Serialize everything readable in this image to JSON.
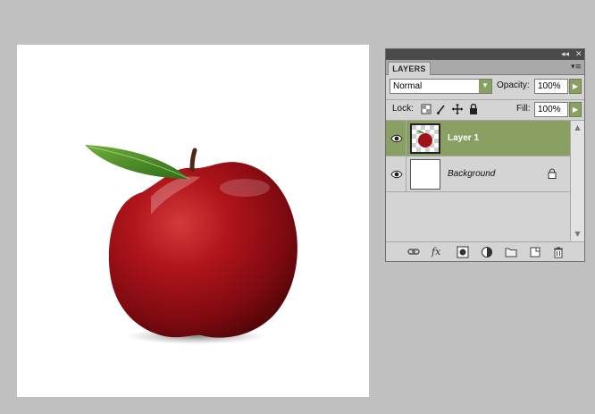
{
  "panel": {
    "tab_label": "LAYERS",
    "collapse_glyph": "◂◂",
    "close_glyph": "✕",
    "menu_glyph": "▾≡",
    "blend_mode": "Normal",
    "opacity_label": "Opacity:",
    "opacity_value": "100%",
    "lock_label": "Lock:",
    "fill_label": "Fill:",
    "fill_value": "100%",
    "layers": [
      {
        "name": "Layer 1",
        "selected": true,
        "visible": true,
        "icon": "apple-thumbnail"
      },
      {
        "name": "Background",
        "selected": false,
        "visible": true,
        "locked": true,
        "icon": "white-thumbnail"
      }
    ],
    "bottom_icons": [
      "link-layers-icon",
      "fx-icon",
      "mask-icon",
      "adjustment-icon",
      "folder-icon",
      "new-layer-icon",
      "trash-icon"
    ],
    "fx_text": "fx"
  },
  "colors": {
    "panel_bg": "#d4d4d4",
    "selection": "#8aa063",
    "workspace": "#c0c0c0"
  }
}
